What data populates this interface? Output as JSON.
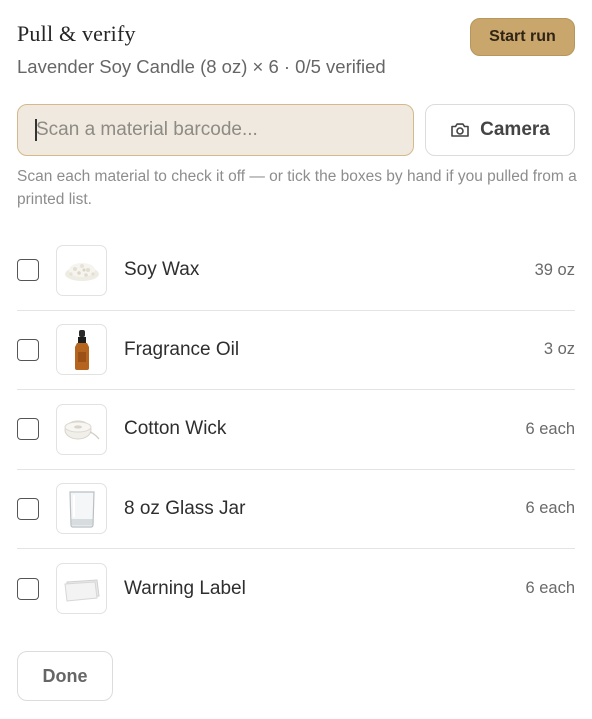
{
  "header": {
    "title": "Pull & verify",
    "subtitle": "Lavender Soy Candle (8 oz) × 6 · 0/5 verified",
    "start_label": "Start run"
  },
  "scan": {
    "placeholder": "Scan a material barcode...",
    "camera_label": "Camera"
  },
  "hint": "Scan each material to check it off — or tick the boxes by hand if you pulled from a printed list.",
  "materials": [
    {
      "name": "Soy Wax",
      "qty": "39 oz",
      "icon": "soy-wax-flakes",
      "checked": false
    },
    {
      "name": "Fragrance Oil",
      "qty": "3 oz",
      "icon": "amber-dropper-bottle",
      "checked": false
    },
    {
      "name": "Cotton Wick",
      "qty": "6 each",
      "icon": "wick-spool",
      "checked": false
    },
    {
      "name": "8 oz Glass Jar",
      "qty": "6 each",
      "icon": "glass-jar",
      "checked": false
    },
    {
      "name": "Warning Label",
      "qty": "6 each",
      "icon": "label-sticker",
      "checked": false
    }
  ],
  "footer": {
    "done_label": "Done"
  },
  "colors": {
    "accent": "#c9a66b",
    "input_bg": "#efe9df",
    "input_border": "#d6b98a"
  }
}
